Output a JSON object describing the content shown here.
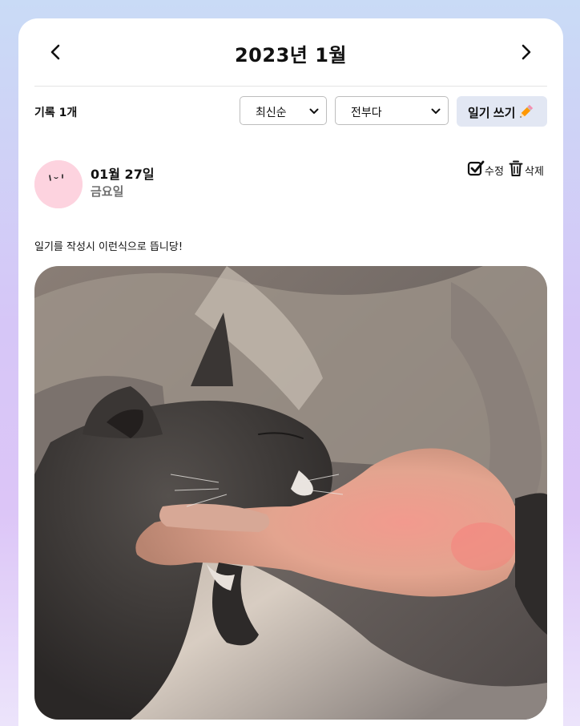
{
  "header": {
    "title": "2023년 1월",
    "prev_icon": "chevron-left-icon",
    "next_icon": "chevron-right-icon"
  },
  "toolbar": {
    "count_label": "기록 1개",
    "sort_selected": "최신순",
    "filter_selected": "전부다",
    "write_label": "일기 쓰기",
    "write_icon": "pencil-icon"
  },
  "entry": {
    "date": "01월 27일",
    "weekday": "금요일",
    "edit_label": "수정",
    "delete_label": "삭제",
    "text": "일기를 작성시 이런식으로 뜹니당!",
    "avatar_color": "#fdd3df",
    "photo_subject": "gray cat resting its chin on a hand"
  },
  "colors": {
    "write_button_bg": "#e2e7f3",
    "weekday_text": "#6f6f6f"
  }
}
